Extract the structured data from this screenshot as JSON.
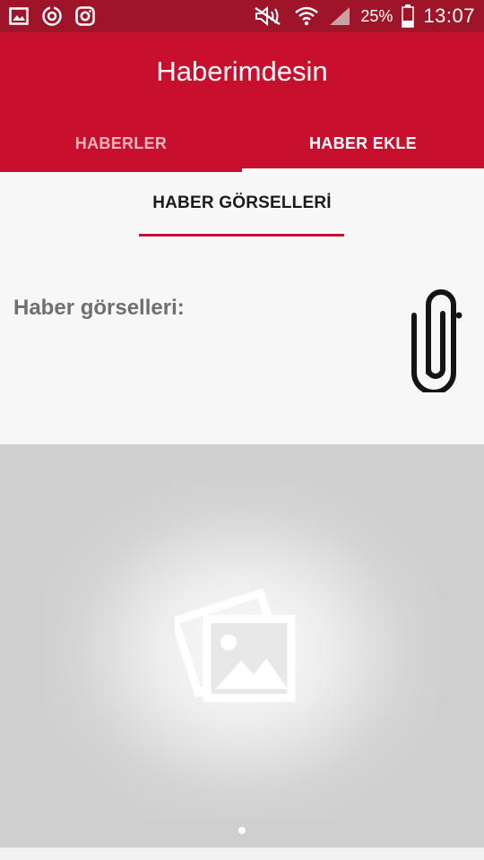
{
  "status_bar": {
    "battery_percent": "25%",
    "time": "13:07",
    "icons": [
      "gallery-icon",
      "sync-icon",
      "instagram-icon",
      "mute-icon",
      "wifi-icon",
      "signal-icon",
      "battery-icon"
    ]
  },
  "app": {
    "title": "Haberimdesin"
  },
  "tabs": [
    {
      "label": "HABERLER",
      "active": false
    },
    {
      "label": "HABER EKLE",
      "active": true
    }
  ],
  "section": {
    "heading": "HABER GÖRSELLERİ",
    "field_label": "Haber görselleri:",
    "attach_icon": "paperclip-icon"
  },
  "gallery": {
    "placeholder_icon": "image-placeholder-icon",
    "page_count": 1,
    "current_page": 1
  },
  "colors": {
    "primary": "#c8102e",
    "status_bar": "#9e1428",
    "tab_inactive": "#f3b4bd",
    "label_gray": "#6f6f6f",
    "gallery_bg": "#cfcfcf"
  }
}
